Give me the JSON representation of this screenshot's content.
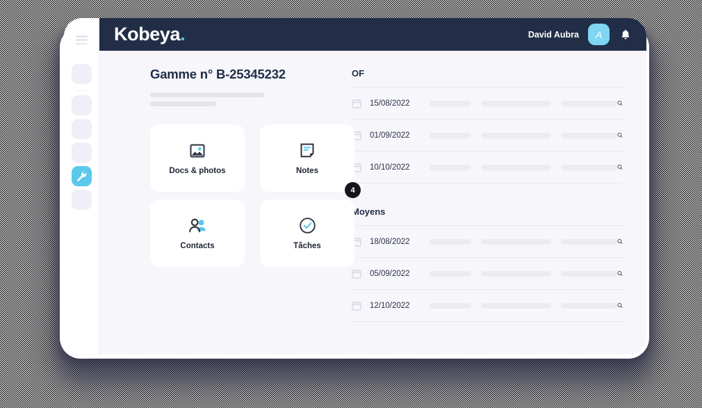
{
  "brand": {
    "name": "Kobeya",
    "dot": "."
  },
  "header": {
    "user_name": "David Aubra",
    "avatar_initial": "A",
    "bell_icon": "bell-icon",
    "accent_color": "#5cc8ec",
    "bar_color": "#222e47"
  },
  "sidebar": {
    "menu_icon": "hamburger-menu-icon",
    "items": [
      {
        "name": "nav-item-1",
        "active": false,
        "icon": ""
      },
      {
        "name": "nav-item-2",
        "active": false,
        "icon": ""
      },
      {
        "name": "nav-item-3",
        "active": false,
        "icon": ""
      },
      {
        "name": "nav-item-4",
        "active": false,
        "icon": ""
      },
      {
        "name": "nav-item-tools",
        "active": true,
        "icon": "wrench-icon"
      },
      {
        "name": "nav-item-6",
        "active": false,
        "icon": ""
      }
    ]
  },
  "main": {
    "page_title": "Gamme n° B-25345232",
    "tiles": [
      {
        "label": "Docs & photos",
        "icon": "image-icon",
        "badge": null
      },
      {
        "label": "Notes",
        "icon": "note-icon",
        "badge": "4"
      },
      {
        "label": "Contacts",
        "icon": "contacts-icon",
        "badge": null
      },
      {
        "label": "Tâches",
        "icon": "check-circle-icon",
        "badge": null
      }
    ],
    "sections": [
      {
        "title": "OF",
        "rows": [
          {
            "date": "15/08/2022",
            "calendar_icon": "calendar-icon",
            "search_icon": "search-icon"
          },
          {
            "date": "01/09/2022",
            "calendar_icon": "calendar-icon",
            "search_icon": "search-icon"
          },
          {
            "date": "10/10/2022",
            "calendar_icon": "calendar-icon",
            "search_icon": "search-icon"
          }
        ]
      },
      {
        "title": "Moyens",
        "rows": [
          {
            "date": "18/08/2022",
            "calendar_icon": "calendar-icon",
            "search_icon": "search-icon"
          },
          {
            "date": "05/09/2022",
            "calendar_icon": "calendar-icon",
            "search_icon": "search-icon"
          },
          {
            "date": "12/10/2022",
            "calendar_icon": "calendar-icon",
            "search_icon": "search-icon"
          }
        ]
      }
    ]
  }
}
